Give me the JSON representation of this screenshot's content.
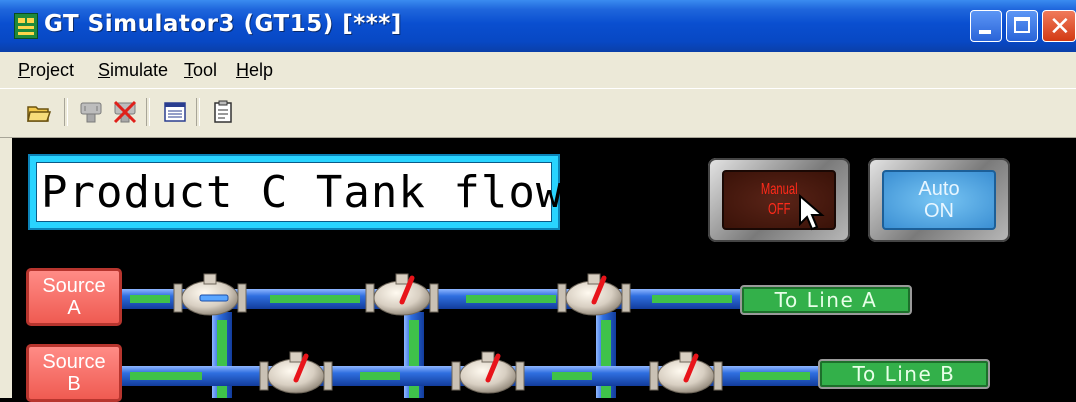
{
  "window": {
    "title": "GT Simulator3 (GT15)  [***]",
    "controls": [
      "minimize",
      "maximize",
      "close"
    ]
  },
  "menu": {
    "items": [
      "Project",
      "Simulate",
      "Tool",
      "Help"
    ]
  },
  "toolbar": {
    "icons": [
      "open-folder-icon",
      "connect-icon",
      "disconnect-icon",
      "list-icon",
      "properties-icon"
    ]
  },
  "screen": {
    "title": "Product C Tank flow",
    "manual_switch": {
      "line1": "Manual",
      "line2": "OFF"
    },
    "auto_switch": {
      "line1": "Auto",
      "line2": "ON"
    },
    "source_a": {
      "line1": "Source",
      "line2": "A"
    },
    "source_b": {
      "line1": "Source",
      "line2": "B"
    },
    "to_line_a": "To Line A",
    "to_line_b": "To Line B"
  },
  "colors": {
    "titlebar": "#0a4fd0",
    "pipe_blue": "#2f6fe0",
    "pipe_green": "#3fc24a",
    "valve_handle": "#e8141a",
    "source_button": "#ef6a62",
    "to_line_button": "#33b04a",
    "auto_switch": "#5aa8e6",
    "manual_switch": "#4a1a10"
  }
}
